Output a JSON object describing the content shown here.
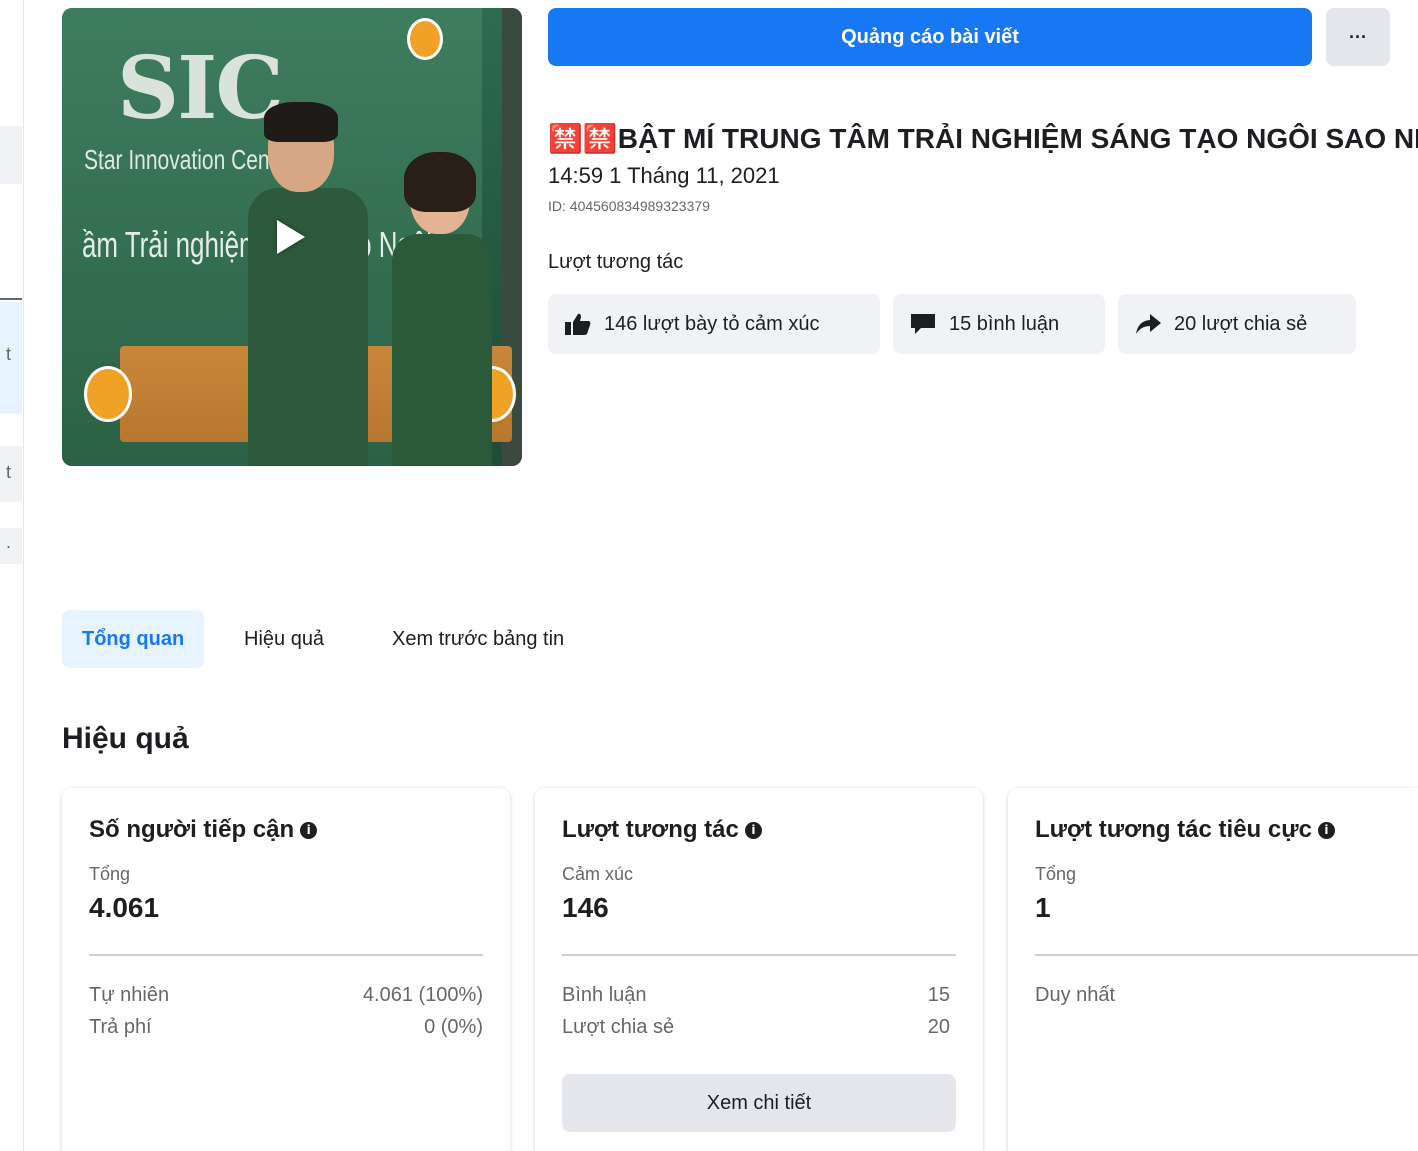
{
  "header": {
    "promote_label": "Quảng cáo bài viết",
    "more_label": "···"
  },
  "post": {
    "title": "🈲🈲BẬT MÍ TRUNG TÂM TRẢI NGHIỆM SÁNG TẠO NGÔI SAO NHỎ",
    "date": "14:59 1 Tháng 11, 2021",
    "id_text": "ID: 404560834989323379",
    "thumbnail": {
      "brand": "SIC",
      "brand_sub": "Star Innovation Center",
      "banner_text": "ầm Trải nghiệm Sáng tạo Ngôi sao"
    }
  },
  "engagement": {
    "label": "Lượt tương tác",
    "reactions": "146 lượt bày tỏ cảm xúc",
    "comments": "15 bình luận",
    "shares": "20 lượt chia sẻ"
  },
  "tabs": [
    {
      "label": "Tổng quan",
      "active": true
    },
    {
      "label": "Hiệu quả",
      "active": false
    },
    {
      "label": "Xem trước bảng tin",
      "active": false
    }
  ],
  "section_title": "Hiệu quả",
  "cards": [
    {
      "title": "Số người tiếp cận",
      "sub": "Tổng",
      "big": "4.061",
      "rows": [
        {
          "label": "Tự nhiên",
          "value": "4.061 (100%)"
        },
        {
          "label": "Trả phí",
          "value": "0 (0%)"
        }
      ]
    },
    {
      "title": "Lượt tương tác",
      "sub": "Cảm xúc",
      "big": "146",
      "rows": [
        {
          "label": "Bình luận",
          "value": "15"
        },
        {
          "label": "Lượt chia sẻ",
          "value": "20"
        }
      ],
      "button": "Xem chi tiết"
    },
    {
      "title": "Lượt tương tác tiêu cực",
      "sub": "Tổng",
      "big": "1",
      "rows": [
        {
          "label": "Duy nhất",
          "value": ""
        }
      ]
    }
  ],
  "left_rail": {
    "chars": [
      "t",
      "t",
      "."
    ]
  },
  "colors": {
    "accent": "#1877f2",
    "chip_bg": "#f0f2f5",
    "tab_active_bg": "#e7f3ff"
  }
}
